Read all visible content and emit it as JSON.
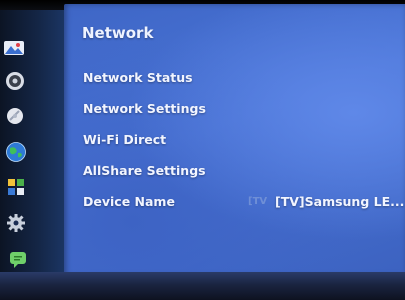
{
  "panel": {
    "title": "Network"
  },
  "menu": {
    "items": [
      {
        "label": "Network Status"
      },
      {
        "label": "Network Settings"
      },
      {
        "label": "Wi-Fi Direct"
      },
      {
        "label": "AllShare Settings"
      },
      {
        "label": "Device Name",
        "value_prefix": "[TV",
        "value": "[TV]Samsung LE..."
      }
    ]
  },
  "sidebar": {
    "icons": [
      "picture-icon",
      "sound-icon",
      "broadcast-icon",
      "network-globe-icon",
      "system-icon",
      "support-gear-icon",
      "support-chat-icon"
    ]
  },
  "colors": {
    "panel": "#4a74d6",
    "sidebar": "#142646",
    "text": "#f2f5ff"
  }
}
